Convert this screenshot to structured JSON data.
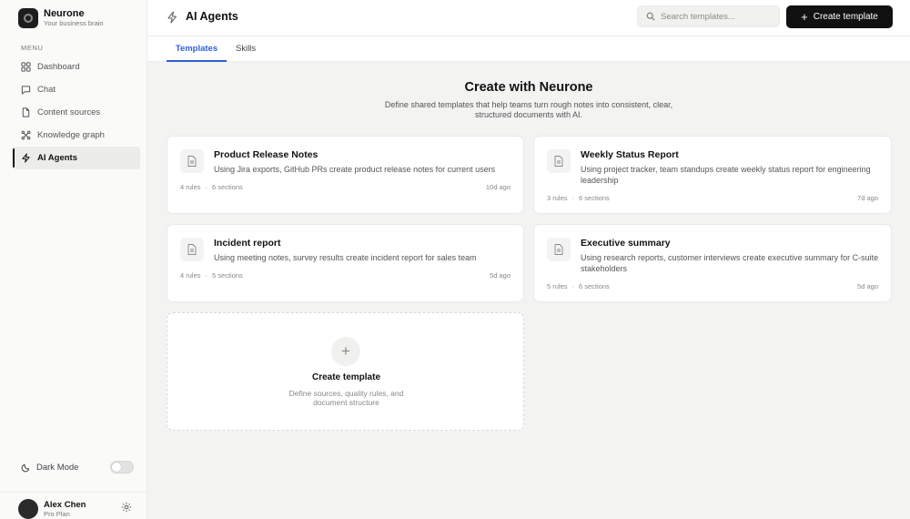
{
  "brand": {
    "name": "Neurone",
    "tagline": "Your business brain"
  },
  "sidebar": {
    "menu_label": "MENU",
    "items": [
      {
        "label": "Dashboard",
        "icon": "grid-icon"
      },
      {
        "label": "Chat",
        "icon": "chat-icon"
      },
      {
        "label": "Content sources",
        "icon": "file-icon"
      },
      {
        "label": "Knowledge graph",
        "icon": "graph-icon"
      },
      {
        "label": "AI Agents",
        "icon": "bolt-icon",
        "active": true
      }
    ],
    "dark_mode_label": "Dark Mode",
    "dark_mode_on": false
  },
  "user": {
    "name": "Alex Chen",
    "plan": "Pro Plan"
  },
  "header": {
    "title": "AI Agents",
    "search_placeholder": "Search templates...",
    "create_label": "Create template"
  },
  "tabs": [
    {
      "label": "Templates",
      "active": true
    },
    {
      "label": "Skills",
      "active": false
    }
  ],
  "main": {
    "title": "Create with Neurone",
    "subtitle": "Define shared templates that help teams turn rough notes into consistent, clear, structured documents with AI.",
    "templates": [
      {
        "title": "Product Release Notes",
        "description": "Using Jira exports, GitHub PRs create product release notes for current users",
        "rules": "4 rules",
        "sections": "6 sections",
        "age": "10d ago"
      },
      {
        "title": "Weekly Status Report",
        "description": "Using project tracker, team standups create weekly status report for engineering leadership",
        "rules": "3 rules",
        "sections": "6 sections",
        "age": "7d ago"
      },
      {
        "title": "Incident report",
        "description": "Using meeting notes, survey results create incident report for sales team",
        "rules": "4 rules",
        "sections": "5 sections",
        "age": "5d ago"
      },
      {
        "title": "Executive summary",
        "description": "Using research reports, customer interviews create executive summary for C-suite stakeholders",
        "rules": "5 rules",
        "sections": "6 sections",
        "age": "5d ago"
      }
    ],
    "new_card": {
      "plus": "+",
      "title": "Create template",
      "description": "Define sources, quality rules, and document structure"
    }
  },
  "colors": {
    "accent": "#2f5fd6",
    "primary_button": "#111111",
    "canvas": "#f3f3f2"
  }
}
